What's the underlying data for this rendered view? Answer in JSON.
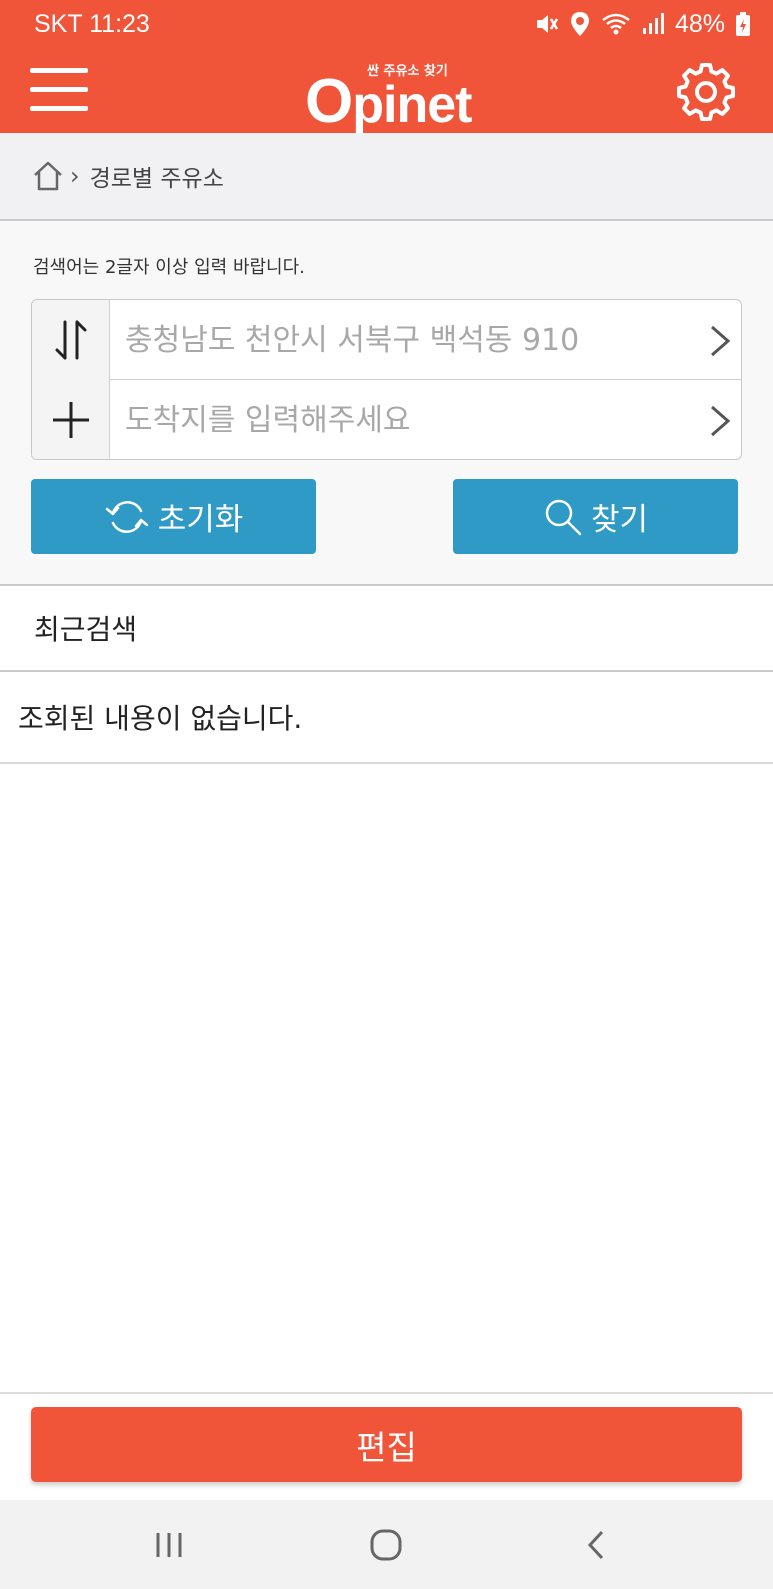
{
  "status_bar": {
    "carrier_time": "SKT 11:23",
    "battery": "48%",
    "icons": [
      "mute-icon",
      "location-icon",
      "wifi-icon",
      "signal-icon",
      "battery-icon"
    ]
  },
  "header": {
    "logo_sub": "싼 주유소 찾기",
    "logo_first": "O",
    "logo_rest": "pinet",
    "menu_icon": "hamburger-menu-icon",
    "settings_icon": "gear-icon"
  },
  "breadcrumb": {
    "home_icon": "home-icon",
    "current": "경로별 주유소"
  },
  "search": {
    "hint": "검색어는 2글자 이상 입력 바랍니다.",
    "origin_placeholder": "충청남도 천안시 서북구 백석동 910",
    "destination_placeholder": "도착지를 입력해주세요",
    "reset_label": "초기화",
    "search_label": "찾기"
  },
  "recent": {
    "title": "최근검색",
    "empty_message": "조회된 내용이 없습니다."
  },
  "footer": {
    "edit_label": "편집"
  },
  "colors": {
    "brand": "#f0553a",
    "button_blue": "#2f9ac6"
  }
}
